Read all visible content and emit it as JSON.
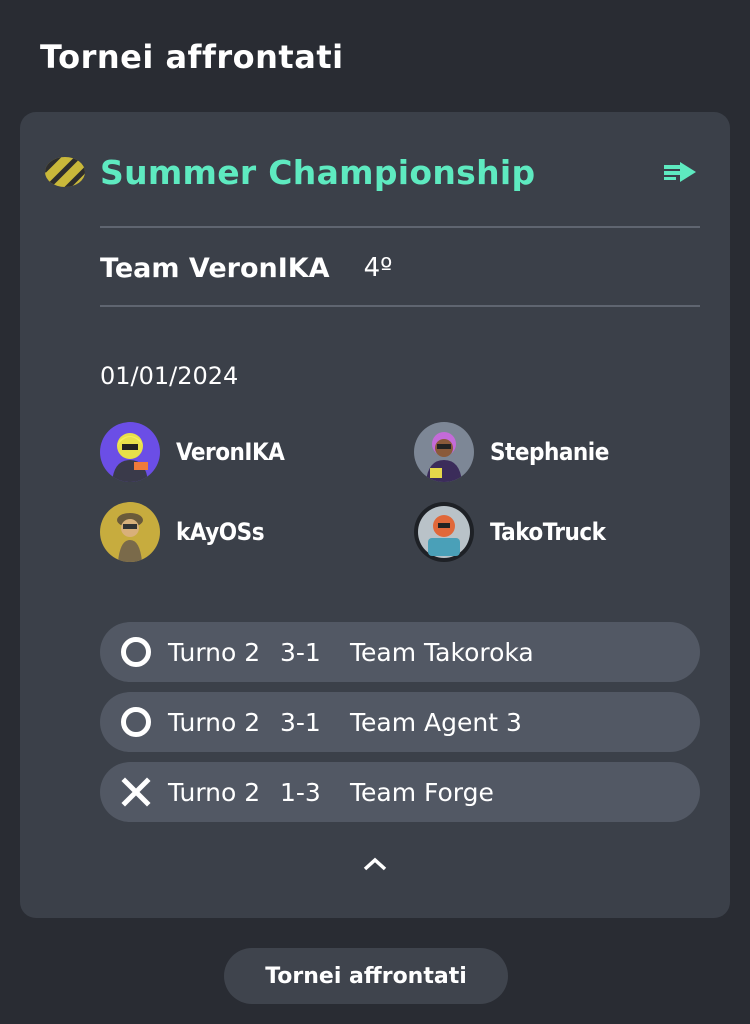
{
  "section": {
    "title": "Tornei affrontati"
  },
  "tournament": {
    "name": "Summer Championship",
    "name_color": "#5eeac0",
    "badge_icon": "tournament-badge-icon",
    "team": "Team VeronIKA",
    "placement": "4º",
    "date": "01/01/2024"
  },
  "players": [
    {
      "name": "VeronIKA"
    },
    {
      "name": "Stephanie"
    },
    {
      "name": "kAyOSs"
    },
    {
      "name": "TakoTruck"
    }
  ],
  "matches": [
    {
      "result": "win",
      "result_icon": "circle-icon",
      "round": "Turno 2",
      "score": "3-1",
      "opponent": "Team Takoroka"
    },
    {
      "result": "win",
      "result_icon": "circle-icon",
      "round": "Turno 2",
      "score": "3-1",
      "opponent": "Team Agent 3"
    },
    {
      "result": "loss",
      "result_icon": "cross-icon",
      "round": "Turno 2",
      "score": "1-3",
      "opponent": "Team Forge"
    }
  ],
  "footer": {
    "button_label": "Tornei affrontati"
  }
}
